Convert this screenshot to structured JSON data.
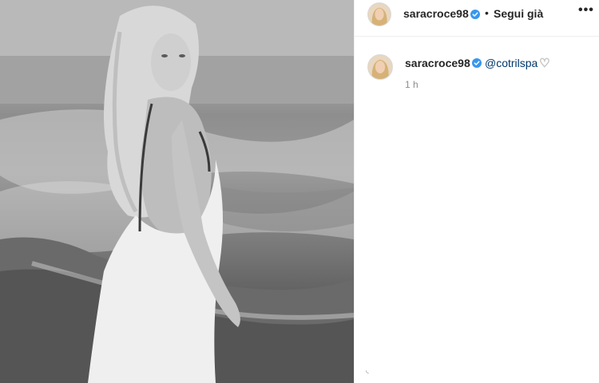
{
  "post": {
    "image_alt": "Black-and-white photo of a woman in a white backless dress on a beach"
  },
  "header": {
    "username": "saracroce98",
    "separator": "•",
    "follow_label": "Segui già",
    "more_label": "•••"
  },
  "caption": {
    "username": "saracroce98",
    "mention": "@cotrilspa",
    "emoji": "♡",
    "time": "1 h"
  },
  "colors": {
    "verified_blue": "#3897f0",
    "link_blue": "#00376b",
    "muted_text": "#8e8e8e",
    "border": "#efefef"
  },
  "icons": {
    "verified": "verified-badge-icon",
    "more": "more-options-icon",
    "heart": "white-heart-emoji"
  }
}
